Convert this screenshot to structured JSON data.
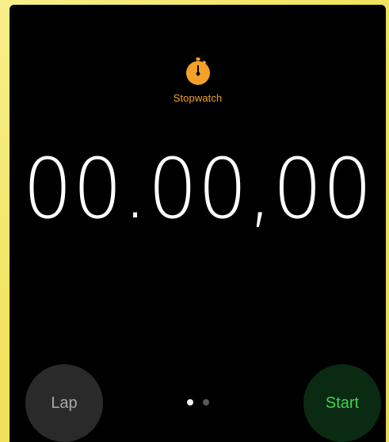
{
  "app": {
    "title": "Stopwatch",
    "icon": "stopwatch-icon",
    "accent_color": "#f4a12a"
  },
  "timer": {
    "display": "00.00,00"
  },
  "controls": {
    "lap_label": "Lap",
    "start_label": "Start",
    "lap_bg": "#2a2a2a",
    "lap_text": "#a9a9a9",
    "start_bg": "#0b2a12",
    "start_text": "#3fd14f"
  },
  "pager": {
    "pages": 2,
    "active_index": 0
  }
}
